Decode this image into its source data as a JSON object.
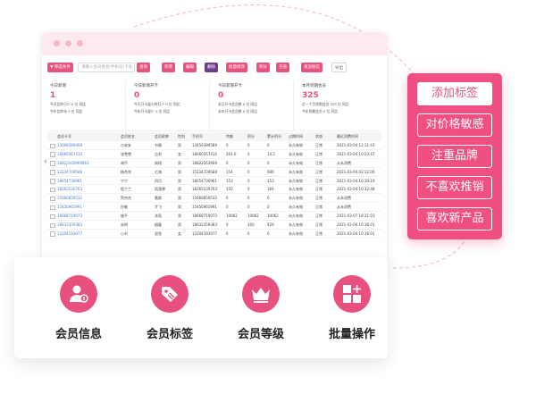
{
  "colors": {
    "accent": "#e8537d",
    "panel": "#f04f82",
    "link": "#4a7fc9",
    "tag": "#5b8fd6"
  },
  "toolbar": {
    "filter_label": "▼ 筛选条件",
    "search_placeholder": "请输入会员姓名/手机号/卡号",
    "search_button": "查询",
    "buttons": [
      "新增",
      "编辑",
      "删除",
      "批量修改",
      "积分",
      "充值",
      "发送短信",
      "导出"
    ]
  },
  "stats": [
    {
      "label": "今日新增",
      "value": "1",
      "lines": [
        "今天比昨日少 0 位 同比",
        "今年比昨年 0 位 同比"
      ]
    },
    {
      "label": "今日新增开卡",
      "value": "0",
      "lines": [
        "今天开卡量与昨日少 0 位 同比",
        "今年开卡量少 0 位 同比"
      ]
    },
    {
      "label": "今日新增开卡",
      "value": "0",
      "lines": [
        "本日开卡会员数 0 位 同比",
        "本年开卡会员数 0 位 同比"
      ]
    },
    {
      "label": "本月到期会员",
      "value": "325",
      "lines": [
        "近一个月到期会员 325 位 同比",
        "今年到期会员 0 位 同比"
      ]
    }
  ],
  "table": {
    "headers": [
      "会员卡号",
      "会员姓名",
      "会员昵称",
      "性别",
      "手机号",
      "余额",
      "积分",
      "累计积分",
      "过期时间",
      "状态",
      "最近消费时间"
    ],
    "rows": [
      [
        "13698389469",
        "沙安安",
        "书雅",
        "男",
        "13459389589",
        "0",
        "0",
        "0",
        "永久有效",
        "正常",
        "2021-03-04 12:11:41"
      ],
      [
        "18666567410",
        "张雪雪",
        "吉利",
        "女",
        "18666567410",
        "291.0",
        "0",
        "14.2",
        "永久有效",
        "正常",
        "2021-03-04 10:03:47"
      ],
      [
        "18823100969861",
        "胡平",
        "周翔",
        "男",
        "18822563969",
        "0",
        "0",
        "0",
        "永久有效",
        "正常",
        "从未消费"
      ],
      [
        "13234709588",
        "杨秀秀",
        "七海",
        "男",
        "15234709588",
        "154",
        "0",
        "686",
        "永久有效",
        "正常",
        "2021-03-04 02:12:06"
      ],
      [
        "18654736961",
        "宁宁",
        "四月",
        "男",
        "18654736961",
        "153",
        "0",
        "153",
        "永久有效",
        "正常",
        "2021-03-04 10:30:19"
      ],
      [
        "18265530763",
        "程兰兰",
        "雨落寒",
        "男",
        "18265530763",
        "150",
        "0",
        "164",
        "永久有效",
        "正常",
        "2021-03-04 10:12:48"
      ],
      [
        "15666859532",
        "贺杰杰",
        "素颜",
        "男",
        "15666859532",
        "0",
        "0",
        "0",
        "永久有效",
        "正常",
        "从未消费"
      ],
      [
        "15456965991",
        "孙敏",
        "才飞",
        "男",
        "15456965991",
        "0",
        "0",
        "0",
        "永久有效",
        "正常",
        "从未消费"
      ],
      [
        "18668719073",
        "姚平",
        "沐雨",
        "男",
        "18668719073",
        "10062",
        "10062",
        "10062",
        "永久有效",
        "正常",
        "2021-03-07 18:21:03"
      ],
      [
        "18632359383",
        "宋明",
        "烟暖",
        "男",
        "18632359383",
        "0",
        "100",
        "429",
        "永久有效",
        "正常",
        "2021-03-06 16:36:01"
      ],
      [
        "13204193977",
        "小刘",
        "君弦",
        "女",
        "13204193977",
        "0",
        "0",
        "0",
        "永久有效",
        "正常",
        "2021-03-04 10:16:01"
      ]
    ]
  },
  "features": [
    {
      "label": "会员信息",
      "icon": "member-info-icon"
    },
    {
      "label": "会员标签",
      "icon": "member-tag-icon"
    },
    {
      "label": "会员等级",
      "icon": "crown-icon"
    },
    {
      "label": "批量操作",
      "icon": "grid-plus-icon"
    }
  ],
  "tags": [
    "添加标签",
    "对价格敏感",
    "注重品牌",
    "不喜欢推销",
    "喜欢新产品"
  ]
}
